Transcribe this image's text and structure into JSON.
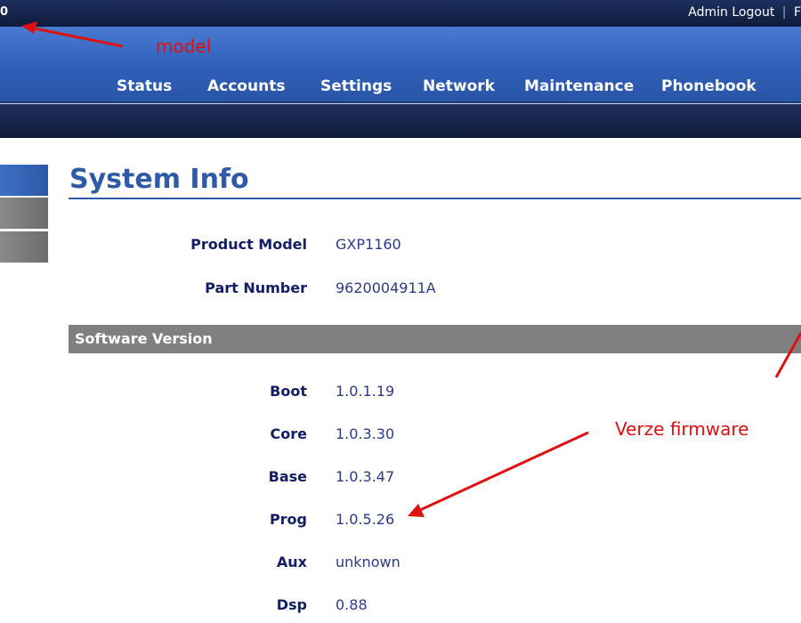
{
  "header": {
    "model_code": "0",
    "admin_label": "Admin",
    "logout_label": "Logout",
    "separator": "|",
    "cut_link": "F"
  },
  "nav": {
    "items": [
      {
        "label": "Status"
      },
      {
        "label": "Accounts"
      },
      {
        "label": "Settings"
      },
      {
        "label": "Network"
      },
      {
        "label": "Maintenance"
      },
      {
        "label": "Phonebook"
      }
    ]
  },
  "page": {
    "title": "System Info"
  },
  "product": [
    {
      "label": "Product Model",
      "value": "GXP1160"
    },
    {
      "label": "Part Number",
      "value": "9620004911A"
    }
  ],
  "software": {
    "header": "Software Version",
    "rows": [
      {
        "label": "Boot",
        "value": "1.0.1.19"
      },
      {
        "label": "Core",
        "value": "1.0.3.30"
      },
      {
        "label": "Base",
        "value": "1.0.3.47"
      },
      {
        "label": "Prog",
        "value": "1.0.5.26"
      },
      {
        "label": "Aux",
        "value": "unknown"
      },
      {
        "label": "Dsp",
        "value": "0.88"
      }
    ]
  },
  "annotations": {
    "model": "model",
    "firmware": "Verze firmware",
    "color": "#e01010"
  },
  "colors": {
    "nav_blue": "#2f5fb8",
    "dark_navy": "#0f1b3c",
    "title_blue": "#2f5aa8",
    "label_navy": "#121e66",
    "section_gray": "#808080"
  }
}
